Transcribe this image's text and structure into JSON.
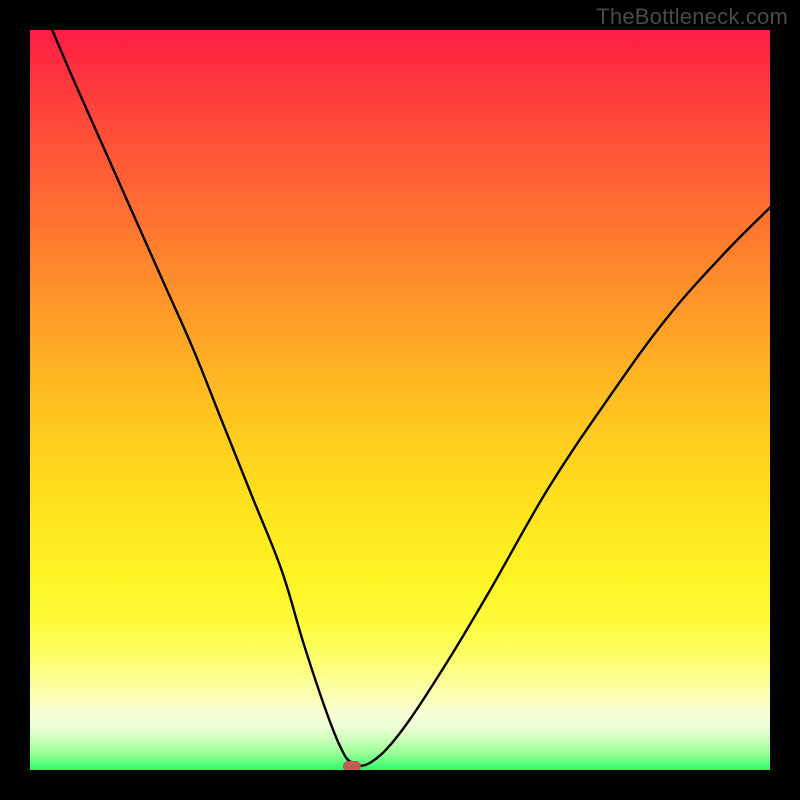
{
  "watermark": {
    "text": "TheBottleneck.com"
  },
  "chart_data": {
    "type": "line",
    "title": "",
    "xlabel": "",
    "ylabel": "",
    "xlim": [
      0,
      100
    ],
    "ylim": [
      0,
      100
    ],
    "grid": false,
    "legend": false,
    "background_gradient_stops": [
      {
        "pos": 0,
        "color": "#ff1c44"
      },
      {
        "pos": 50,
        "color": "#ffb922"
      },
      {
        "pos": 85,
        "color": "#fdffa6"
      },
      {
        "pos": 100,
        "color": "#2bfc6d"
      }
    ],
    "series": [
      {
        "name": "bottleneck-curve",
        "x": [
          3,
          6,
          10,
          14,
          18,
          22,
          26,
          30,
          34,
          37,
          40,
          42,
          43.5,
          46,
          50,
          56,
          62,
          70,
          78,
          86,
          94,
          100
        ],
        "y": [
          100,
          93,
          84,
          75,
          66,
          57,
          47,
          37,
          27,
          17,
          8,
          3,
          1,
          1,
          5,
          14,
          24,
          38,
          50,
          61,
          70,
          76
        ]
      }
    ],
    "marker": {
      "x": 43.5,
      "y": 0.5,
      "color": "#c45a55"
    }
  }
}
